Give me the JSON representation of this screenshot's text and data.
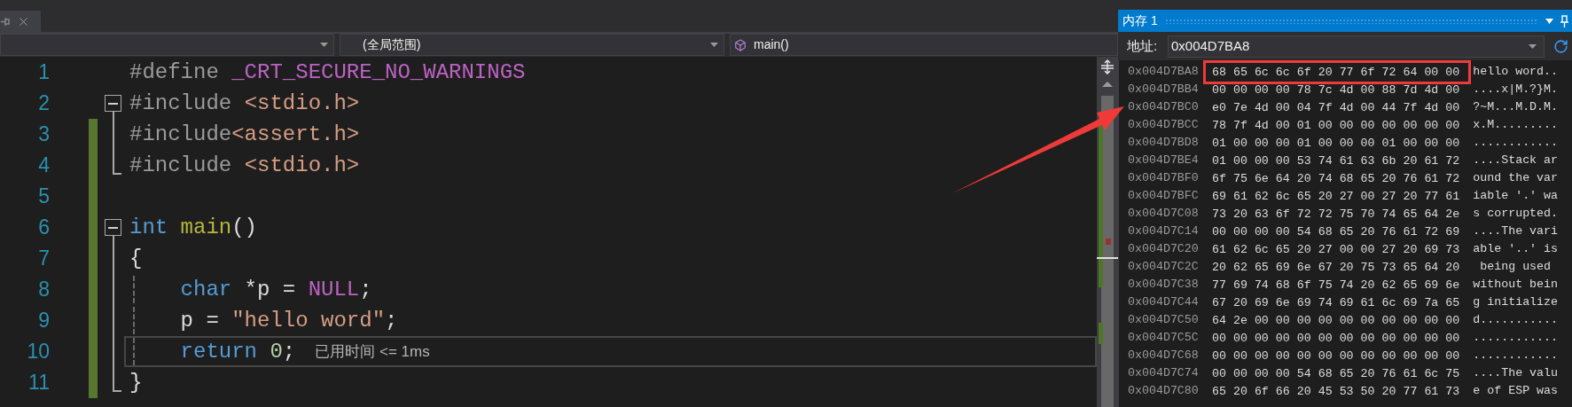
{
  "navigation_bar": {
    "scope": "(全局范围)",
    "member": "main()"
  },
  "editor": {
    "lines": [
      {
        "number": "1",
        "changed": false,
        "guide": false,
        "current": false,
        "tokens": [
          {
            "kind": "preprocessor",
            "text": "#define "
          },
          {
            "kind": "macro",
            "text": "_CRT_SECURE_NO_WARNINGS"
          }
        ]
      },
      {
        "number": "2",
        "changed": false,
        "guide": false,
        "current": false,
        "tokens": [
          {
            "kind": "preprocessor",
            "text": "#include "
          },
          {
            "kind": "string",
            "text": "<stdio.h>"
          }
        ],
        "children": [
          {
            "number": "3",
            "changed": true,
            "guide": false,
            "current": false,
            "tokens": [
              {
                "kind": "preprocessor",
                "text": "#include"
              },
              {
                "kind": "string",
                "text": "<assert.h>"
              }
            ]
          },
          {
            "number": "4",
            "changed": true,
            "guide": false,
            "current": false,
            "tokens": [
              {
                "kind": "preprocessor",
                "text": "#include "
              },
              {
                "kind": "string",
                "text": "<stdio.h>"
              }
            ]
          }
        ]
      },
      {
        "number": "5",
        "changed": true,
        "guide": false,
        "current": false
      },
      {
        "number": "6",
        "changed": true,
        "guide": false,
        "current": false,
        "tokens": [
          {
            "kind": "keyword",
            "text": "int "
          },
          {
            "kind": "function",
            "text": "main"
          },
          {
            "kind": "plain",
            "text": "()"
          }
        ],
        "children": [
          {
            "number": "7",
            "changed": true,
            "guide": false,
            "current": false,
            "tokens": [
              {
                "kind": "plain",
                "text": "{"
              }
            ]
          },
          {
            "number": "8",
            "changed": true,
            "guide": true,
            "current": false,
            "tokens": [
              {
                "kind": "keyword",
                "text": "    char"
              },
              {
                "kind": "plain",
                "text": " *p = "
              },
              {
                "kind": "macro",
                "text": "NULL"
              },
              {
                "kind": "plain",
                "text": ";"
              }
            ]
          },
          {
            "number": "9",
            "changed": true,
            "guide": true,
            "current": false,
            "tokens": [
              {
                "kind": "plain",
                "text": "    p = "
              },
              {
                "kind": "string",
                "text": "\"hello word\""
              },
              {
                "kind": "plain",
                "text": ";"
              }
            ]
          },
          {
            "number": "10",
            "changed": true,
            "guide": true,
            "current": true,
            "tip": "已用时间 <= 1ms",
            "tokens": [
              {
                "kind": "keyword",
                "text": "    return "
              },
              {
                "kind": "number",
                "text": "0"
              },
              {
                "kind": "plain",
                "text": ";"
              }
            ]
          },
          {
            "number": "11",
            "changed": true,
            "guide": false,
            "current": false,
            "tokens": [
              {
                "kind": "plain",
                "text": "}"
              }
            ]
          }
        ]
      }
    ]
  },
  "memory_window": {
    "title": "内存 1",
    "address_label": "地址:",
    "address": "0x004D7BA8",
    "rows": [
      {
        "address": "0x004D7BA8",
        "bytes": "68 65 6c 6c 6f 20 77 6f 72 64 00 00",
        "ascii": "hello word..",
        "highlighted": true
      },
      {
        "address": "0x004D7BB4",
        "bytes": "00 00 00 00 78 7c 4d 00 88 7d 4d 00",
        "ascii": "....x|M.?}M.",
        "highlighted": false
      },
      {
        "address": "0x004D7BC0",
        "bytes": "e0 7e 4d 00 04 7f 4d 00 44 7f 4d 00",
        "ascii": "?~M...M.D.M.",
        "highlighted": false
      },
      {
        "address": "0x004D7BCC",
        "bytes": "78 7f 4d 00 01 00 00 00 00 00 00 00",
        "ascii": "x.M.........",
        "highlighted": false
      },
      {
        "address": "0x004D7BD8",
        "bytes": "01 00 00 00 01 00 00 00 01 00 00 00",
        "ascii": "............",
        "highlighted": false
      },
      {
        "address": "0x004D7BE4",
        "bytes": "01 00 00 00 53 74 61 63 6b 20 61 72",
        "ascii": "....Stack ar",
        "highlighted": false
      },
      {
        "address": "0x004D7BF0",
        "bytes": "6f 75 6e 64 20 74 68 65 20 76 61 72",
        "ascii": "ound the var",
        "highlighted": false
      },
      {
        "address": "0x004D7BFC",
        "bytes": "69 61 62 6c 65 20 27 00 27 20 77 61",
        "ascii": "iable '.' wa",
        "highlighted": false
      },
      {
        "address": "0x004D7C08",
        "bytes": "73 20 63 6f 72 72 75 70 74 65 64 2e",
        "ascii": "s corrupted.",
        "highlighted": false
      },
      {
        "address": "0x004D7C14",
        "bytes": "00 00 00 00 54 68 65 20 76 61 72 69",
        "ascii": "....The vari",
        "highlighted": false
      },
      {
        "address": "0x004D7C20",
        "bytes": "61 62 6c 65 20 27 00 00 27 20 69 73",
        "ascii": "able '..' is",
        "highlighted": false
      },
      {
        "address": "0x004D7C2C",
        "bytes": "20 62 65 69 6e 67 20 75 73 65 64 20",
        "ascii": " being used ",
        "highlighted": false
      },
      {
        "address": "0x004D7C38",
        "bytes": "77 69 74 68 6f 75 74 20 62 65 69 6e",
        "ascii": "without bein",
        "highlighted": false
      },
      {
        "address": "0x004D7C44",
        "bytes": "67 20 69 6e 69 74 69 61 6c 69 7a 65",
        "ascii": "g initialize",
        "highlighted": false
      },
      {
        "address": "0x004D7C50",
        "bytes": "64 2e 00 00 00 00 00 00 00 00 00 00",
        "ascii": "d...........",
        "highlighted": false
      },
      {
        "address": "0x004D7C5C",
        "bytes": "00 00 00 00 00 00 00 00 00 00 00 00",
        "ascii": "............",
        "highlighted": false
      },
      {
        "address": "0x004D7C68",
        "bytes": "00 00 00 00 00 00 00 00 00 00 00 00",
        "ascii": "............",
        "highlighted": false
      },
      {
        "address": "0x004D7C74",
        "bytes": "00 00 00 00 54 68 65 20 76 61 6c 75",
        "ascii": "....The valu",
        "highlighted": false
      },
      {
        "address": "0x004D7C80",
        "bytes": "65 20 6f 66 20 45 53 50 20 77 61 73",
        "ascii": "e of ESP was",
        "highlighted": false
      }
    ]
  }
}
